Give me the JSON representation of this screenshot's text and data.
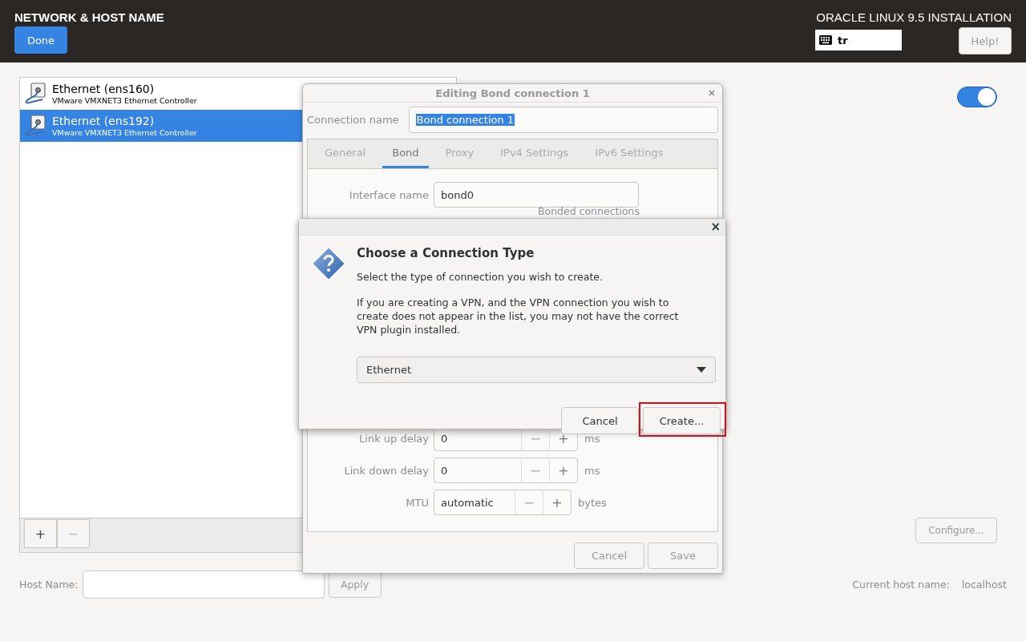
{
  "header": {
    "title": "NETWORK & HOST NAME",
    "done_button": "Done",
    "product": "ORACLE LINUX 9.5 INSTALLATION",
    "keyboard_layout": "tr",
    "help_button": "Help!"
  },
  "devices": [
    {
      "name": "Ethernet (ens160)",
      "description": "VMware VMXNET3 Ethernet Controller",
      "selected": false
    },
    {
      "name": "Ethernet (ens192)",
      "description": "VMware VMXNET3 Ethernet Controller",
      "selected": true
    }
  ],
  "device_toolbar": {
    "add": "+",
    "remove": "−"
  },
  "device_switch": {
    "on": true
  },
  "configure_button": "Configure...",
  "host_name": {
    "label": "Host Name:",
    "apply_button": "Apply",
    "current_label": "Current host name:",
    "current_value": "localhost"
  },
  "editor": {
    "title": "Editing Bond connection 1",
    "connection_name_label": "Connection name",
    "connection_name": "Bond connection 1",
    "tabs": [
      {
        "label": "General",
        "selected": false
      },
      {
        "label": "Bond",
        "selected": true
      },
      {
        "label": "Proxy",
        "selected": false
      },
      {
        "label": "IPv4 Settings",
        "selected": false
      },
      {
        "label": "IPv6 Settings",
        "selected": false
      }
    ],
    "interface_label": "Interface name",
    "interface_name": "bond0",
    "bonded_heading": "Bonded connections",
    "spin_rows": [
      {
        "label": "Link up delay",
        "value": "0",
        "minus": "−",
        "plus": "+",
        "unit": "ms"
      },
      {
        "label": "Link down delay",
        "value": "0",
        "minus": "−",
        "plus": "+",
        "unit": "ms"
      },
      {
        "label": "MTU",
        "value": "automatic",
        "minus": "−",
        "plus": "+",
        "unit": "bytes"
      }
    ],
    "buttons": [
      "Cancel",
      "Save"
    ]
  },
  "chooser": {
    "close": "×",
    "heading": "Choose a Connection Type",
    "intro": "Select the type of connection you wish to create.",
    "note": "If you are creating a VPN, and the VPN connection you wish to create does not appear in the list, you may not have the correct VPN plugin installed.",
    "type": "Ethernet",
    "buttons": [
      {
        "label": "Cancel",
        "highlighted": false
      },
      {
        "label": "Create...",
        "highlighted": true
      }
    ]
  }
}
